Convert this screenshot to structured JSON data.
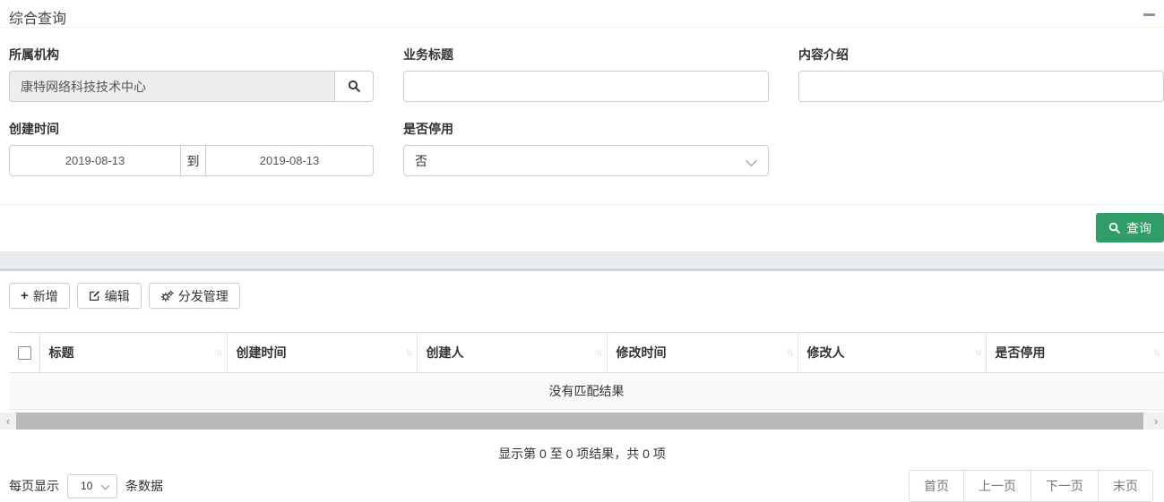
{
  "panel": {
    "title": "综合查询"
  },
  "form": {
    "org": {
      "label": "所属机构",
      "value": "康特网络科技技术中心"
    },
    "biz_title": {
      "label": "业务标题",
      "value": "",
      "placeholder": ""
    },
    "content_intro": {
      "label": "内容介绍",
      "value": "",
      "placeholder": ""
    },
    "create_time": {
      "label": "创建时间",
      "from": "2019-08-13",
      "separator": "到",
      "to": "2019-08-13"
    },
    "disabled": {
      "label": "是否停用",
      "value": "否"
    }
  },
  "actions": {
    "query": "查询"
  },
  "toolbar": {
    "add": "新增",
    "edit": "编辑",
    "dispatch": "分发管理"
  },
  "table": {
    "columns": [
      {
        "label": "标题"
      },
      {
        "label": "创建时间"
      },
      {
        "label": "创建人"
      },
      {
        "label": "修改时间"
      },
      {
        "label": "修改人"
      },
      {
        "label": "是否停用"
      }
    ],
    "empty_text": "没有匹配结果"
  },
  "pagination": {
    "summary": "显示第 0 至 0 项结果，共 0 项",
    "per_page_prefix": "每页显示",
    "per_page_value": "10",
    "per_page_suffix": "条数据",
    "first": "首页",
    "prev": "上一页",
    "next": "下一页",
    "last": "末页"
  },
  "icons": {
    "plus": "+",
    "sort_up": "↑",
    "sort_down": "↓",
    "scroll_left": "‹",
    "scroll_right": "›"
  },
  "colors": {
    "accent_green": "#2f9d68",
    "disabled_input_bg": "#eeeeee",
    "divider_band": "#e9ebf0",
    "scrollbar_thumb": "#b9b9b9"
  }
}
